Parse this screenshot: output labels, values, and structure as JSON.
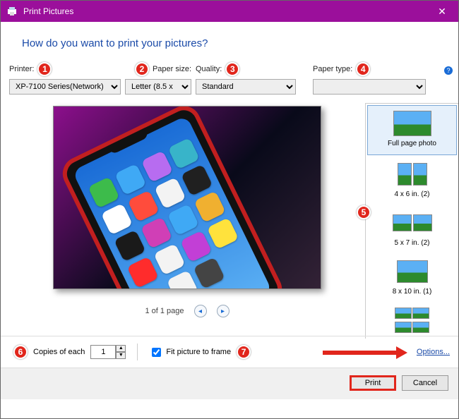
{
  "window": {
    "title": "Print Pictures"
  },
  "heading": "How do you want to print your pictures?",
  "controls": {
    "printer": {
      "label": "Printer:",
      "value": "XP-7100 Series(Network)"
    },
    "paperSize": {
      "label": "Paper size:",
      "value": "Letter (8.5 x"
    },
    "quality": {
      "label": "Quality:",
      "value": "Standard"
    },
    "paperType": {
      "label": "Paper type:",
      "value": ""
    }
  },
  "badges": {
    "b1": "1",
    "b2": "2",
    "b3": "3",
    "b4": "4",
    "b5": "5",
    "b6": "6",
    "b7": "7"
  },
  "pageNav": {
    "label": "1 of 1 page"
  },
  "layouts": {
    "items": [
      {
        "label": "Full page photo"
      },
      {
        "label": "4 x 6 in. (2)"
      },
      {
        "label": "5 x 7 in. (2)"
      },
      {
        "label": "8 x 10 in. (1)"
      },
      {
        "label": ""
      }
    ]
  },
  "bottom": {
    "copiesLabel": "Copies of each",
    "copiesValue": "1",
    "fitLabel": "Fit picture to frame",
    "optionsLabel": "Options..."
  },
  "buttons": {
    "print": "Print",
    "cancel": "Cancel"
  }
}
